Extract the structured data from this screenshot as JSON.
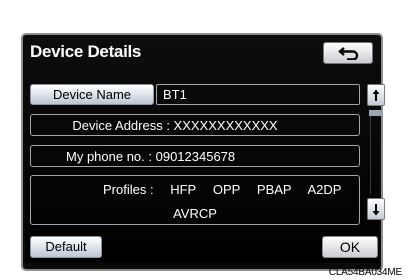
{
  "screen": {
    "title": "Device Details",
    "back_icon": "return-arrow-icon"
  },
  "device_name": {
    "label": "Device Name",
    "value": "BT1"
  },
  "device_address": {
    "text": "Device Address : XXXXXXXXXXXX"
  },
  "phone": {
    "text": "My phone no. : 09012345678"
  },
  "profiles": {
    "label": "Profiles :",
    "items": [
      "HFP",
      "OPP",
      "PBAP",
      "A2DP"
    ],
    "second_line": "AVRCP"
  },
  "scroll": {
    "up_icon": "scroll-up-icon",
    "down_icon": "scroll-down-icon"
  },
  "buttons": {
    "default_label": "Default",
    "ok_label": "OK"
  },
  "image_code": "CLA54BA034ME",
  "colors": {
    "background": "#000000",
    "button_gradient_top": "#ffffff",
    "button_gradient_bottom": "#bcc6d4",
    "border": "#9ea6b0"
  }
}
